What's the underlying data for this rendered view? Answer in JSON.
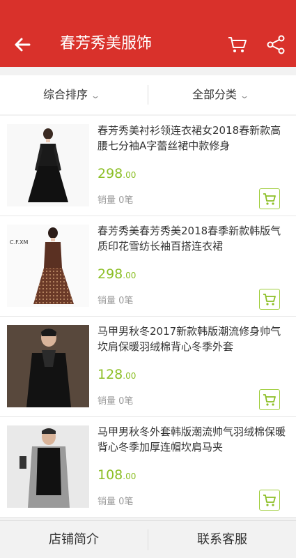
{
  "header": {
    "title": "春芳秀美服饰",
    "back_icon": "back-arrow-icon",
    "cart_icon": "cart-icon",
    "share_icon": "share-icon",
    "color": "#d9312b"
  },
  "filters": [
    {
      "label": "综合排序",
      "icon": "chevron-down-icon"
    },
    {
      "label": "全部分类",
      "icon": "chevron-down-icon"
    }
  ],
  "products": [
    {
      "name": "春芳秀美衬衫领连衣裙女2018春新款高腰七分袖A字蕾丝裙中款修身",
      "price_int": "298",
      "price_dec": ".00",
      "sales": "销量 0笔"
    },
    {
      "name": "春芳秀美春芳秀美2018春季新款韩版气质印花雪纺长袖百搭连衣裙",
      "price_int": "298",
      "price_dec": ".00",
      "sales": "销量 0笔",
      "logo_text": "C.F.XM"
    },
    {
      "name": "马甲男秋冬2017新款韩版潮流修身帅气坎肩保暖羽绒棉背心冬季外套",
      "price_int": "128",
      "price_dec": ".00",
      "sales": "销量 0笔"
    },
    {
      "name": "马甲男秋冬外套韩版潮流帅气羽绒棉保暖背心冬季加厚连帽坎肩马夹",
      "price_int": "108",
      "price_dec": ".00",
      "sales": "销量 0笔"
    }
  ],
  "bottom": {
    "left_label": "店铺简介",
    "right_label": "联系客服"
  },
  "colors": {
    "price": "#8cbf26",
    "header": "#d9312b"
  }
}
